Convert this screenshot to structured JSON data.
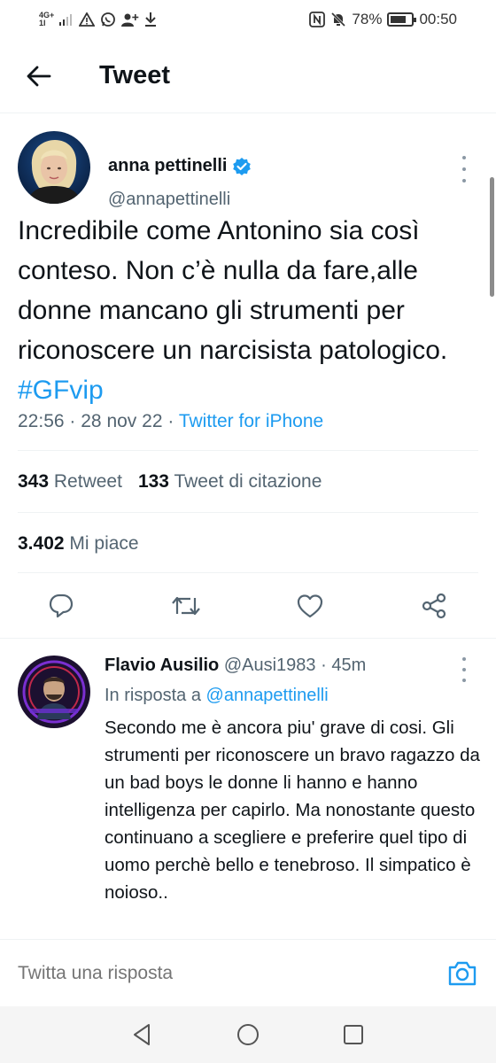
{
  "status_bar": {
    "network_label_top": "4G+",
    "network_label_bottom": "1I",
    "battery_percent": "78%",
    "battery_level": 0.78,
    "time": "00:50"
  },
  "header": {
    "title": "Tweet"
  },
  "tweet": {
    "author_name": "anna pettinelli",
    "author_handle": "@annapettinelli",
    "text": "Incredibile come Antonino sia così conteso. Non c’è nulla da fare,alle donne mancano gli strumenti per riconoscere un narcisista patologico.",
    "hashtag": "#GFvip",
    "time": "22:56",
    "date": "28 nov 22",
    "separator": "·",
    "source": "Twitter for iPhone",
    "retweet_count": "343",
    "retweet_label": "Retweet",
    "quote_count": "133",
    "quote_label": "Tweet di citazione",
    "like_count": "3.402",
    "like_label": "Mi piace"
  },
  "reply": {
    "author_name": "Flavio Ausilio",
    "author_handle": "@Ausi1983",
    "separator": "·",
    "time": "45m",
    "reply_to_prefix": "In risposta a",
    "reply_to_handle": "@annapettinelli",
    "text": "Secondo me è ancora piu' grave di cosi. Gli strumenti per riconoscere un bravo ragazzo da un bad boys le donne li hanno e hanno intelligenza per capirlo. Ma nonostante questo continuano a scegliere e preferire quel tipo di uomo perchè bello e tenebroso. Il simpatico è noioso.."
  },
  "composer": {
    "placeholder": "Twitta una risposta"
  },
  "colors": {
    "accent": "#1d9bf0",
    "text": "#0f1419",
    "secondary": "#536471"
  }
}
